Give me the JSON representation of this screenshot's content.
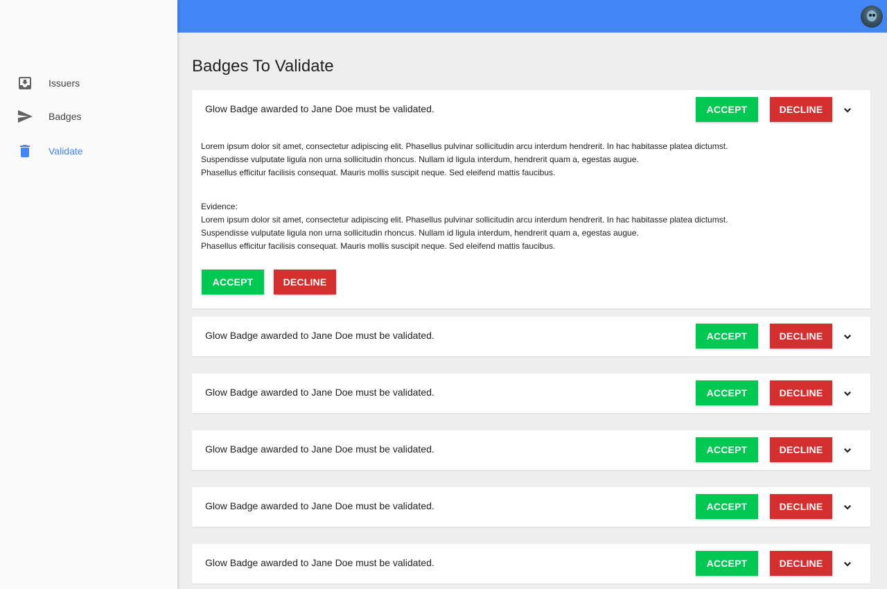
{
  "sidebar": {
    "items": [
      {
        "label": "Issuers",
        "icon": "inbox-download-icon",
        "active": false
      },
      {
        "label": "Badges",
        "icon": "send-icon",
        "active": false
      },
      {
        "label": "Validate",
        "icon": "trash-icon",
        "active": true
      }
    ]
  },
  "header": {
    "avatar": "user-avatar"
  },
  "main": {
    "title": "Badges To Validate",
    "cards": [
      {
        "title": "Glow Badge awarded to Jane Doe must be validated.",
        "accept_label": "ACCEPT",
        "decline_label": "DECLINE",
        "expanded": true,
        "description": "Lorem ipsum dolor sit amet, consectetur adipiscing elit. Phasellus pulvinar sollicitudin arcu interdum hendrerit. In hac habitasse platea dictumst.\nSuspendisse vulputate ligula non urna sollicitudin rhoncus. Nullam id ligula interdum, hendrerit quam a, egestas augue.\n Phasellus efficitur facilisis consequat. Mauris mollis suscipit neque. Sed eleifend mattis faucibus.",
        "evidence_label": "Evidence:",
        "evidence": "Lorem ipsum dolor sit amet, consectetur adipiscing elit. Phasellus pulvinar sollicitudin arcu interdum hendrerit. In hac habitasse platea dictumst.\nSuspendisse vulputate ligula non urna sollicitudin rhoncus. Nullam id ligula interdum, hendrerit quam a, egestas augue.\n Phasellus efficitur facilisis consequat. Mauris mollis suscipit neque. Sed eleifend mattis faucibus."
      },
      {
        "title": "Glow Badge awarded to Jane Doe must be validated.",
        "accept_label": "ACCEPT",
        "decline_label": "DECLINE",
        "expanded": false
      },
      {
        "title": "Glow Badge awarded to Jane Doe must be validated.",
        "accept_label": "ACCEPT",
        "decline_label": "DECLINE",
        "expanded": false
      },
      {
        "title": "Glow Badge awarded to Jane Doe must be validated.",
        "accept_label": "ACCEPT",
        "decline_label": "DECLINE",
        "expanded": false
      },
      {
        "title": "Glow Badge awarded to Jane Doe must be validated.",
        "accept_label": "ACCEPT",
        "decline_label": "DECLINE",
        "expanded": false
      },
      {
        "title": "Glow Badge awarded to Jane Doe must be validated.",
        "accept_label": "ACCEPT",
        "decline_label": "DECLINE",
        "expanded": false
      }
    ]
  },
  "colors": {
    "primary": "#4285f4",
    "accept": "#00c853",
    "decline": "#d32f2f",
    "sidebar_bg": "#fafafa",
    "page_bg": "#eeeeee"
  }
}
